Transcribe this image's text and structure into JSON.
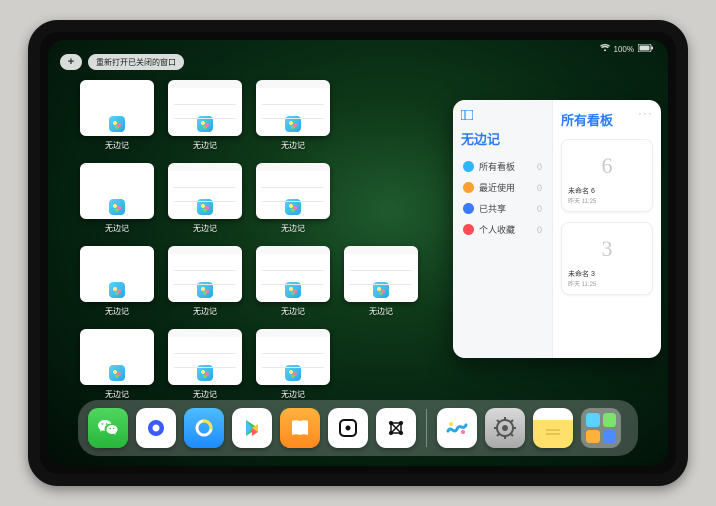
{
  "status": {
    "wifi": "wifi-icon",
    "battery": "100%"
  },
  "top": {
    "plus": "+",
    "reopen_label": "重新打开已关闭的窗口"
  },
  "thumbnails": {
    "label": "无边记"
  },
  "panel": {
    "sidebar_header_icon": "sidebar-icon",
    "more": "···",
    "title_left": "无边记",
    "title_right": "所有看板",
    "items": [
      {
        "label": "所有看板",
        "count": "0",
        "color": "#2fb6ff"
      },
      {
        "label": "最近使用",
        "count": "0",
        "color": "#ff9f2f"
      },
      {
        "label": "已共享",
        "count": "0",
        "color": "#3a7bff"
      },
      {
        "label": "个人收藏",
        "count": "0",
        "color": "#ff4d55"
      }
    ],
    "boards": [
      {
        "sketch": "6",
        "name": "未命名 6",
        "time": "昨天 11:25"
      },
      {
        "sketch": "3",
        "name": "未命名 3",
        "time": "昨天 11:25"
      }
    ]
  },
  "dock": {
    "apps": [
      {
        "name": "wechat",
        "bg": "linear-gradient(#4fd65e,#28b63b)"
      },
      {
        "name": "quark",
        "bg": "#fff"
      },
      {
        "name": "qqbrowser",
        "bg": "linear-gradient(#4dbcff,#1d8cff)"
      },
      {
        "name": "play",
        "bg": "#fff"
      },
      {
        "name": "books",
        "bg": "linear-gradient(#ffb13d,#ff8a1f)"
      },
      {
        "name": "dice",
        "bg": "#fff"
      },
      {
        "name": "grid",
        "bg": "#fff"
      },
      {
        "name": "freeform",
        "bg": "#fff"
      },
      {
        "name": "settings",
        "bg": "linear-gradient(#d9d9d9,#a9a9a9)"
      },
      {
        "name": "notes",
        "bg": "linear-gradient(#fff 0 30%,#ffe06a 30% 100%)"
      }
    ],
    "folder": {
      "tiles": [
        "#5ad1ff",
        "#7ce36b",
        "#ffb13d",
        "#4d8bff"
      ]
    }
  }
}
